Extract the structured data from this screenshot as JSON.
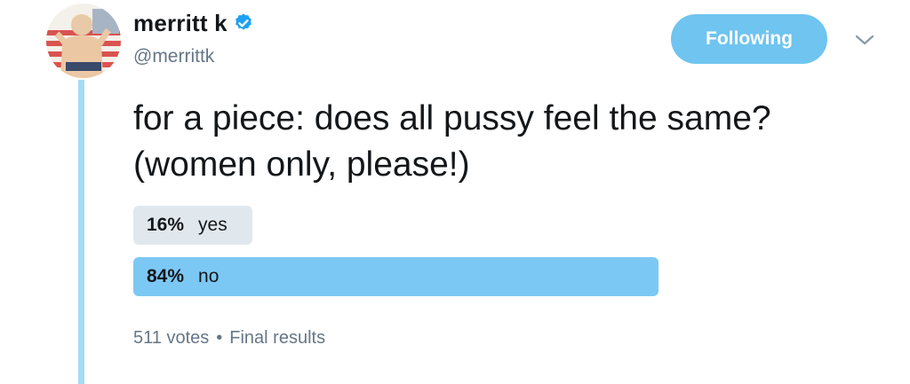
{
  "author": {
    "display_name": "merritt k",
    "handle": "@merrittk",
    "verified": true
  },
  "follow_button": {
    "label": "Following",
    "color": "#6fc4f0"
  },
  "tweet": {
    "text": "for a piece: does all pussy feel the same? (women only, please!)"
  },
  "poll": {
    "options": [
      {
        "percent_label": "16%",
        "label": "yes",
        "percent": 16,
        "winner": false
      },
      {
        "percent_label": "84%",
        "label": "no",
        "percent": 84,
        "winner": true
      }
    ],
    "votes": "511 votes",
    "separator": "•",
    "status": "Final results"
  },
  "icons": {
    "verified": "verified-badge-icon",
    "menu": "chevron-down-icon"
  },
  "colors": {
    "accent": "#1da1f2",
    "thread_line": "#a5dcf3",
    "poll_winner": "#7cc8f4",
    "poll_loser": "#e1e8ed",
    "secondary_text": "#657786"
  }
}
